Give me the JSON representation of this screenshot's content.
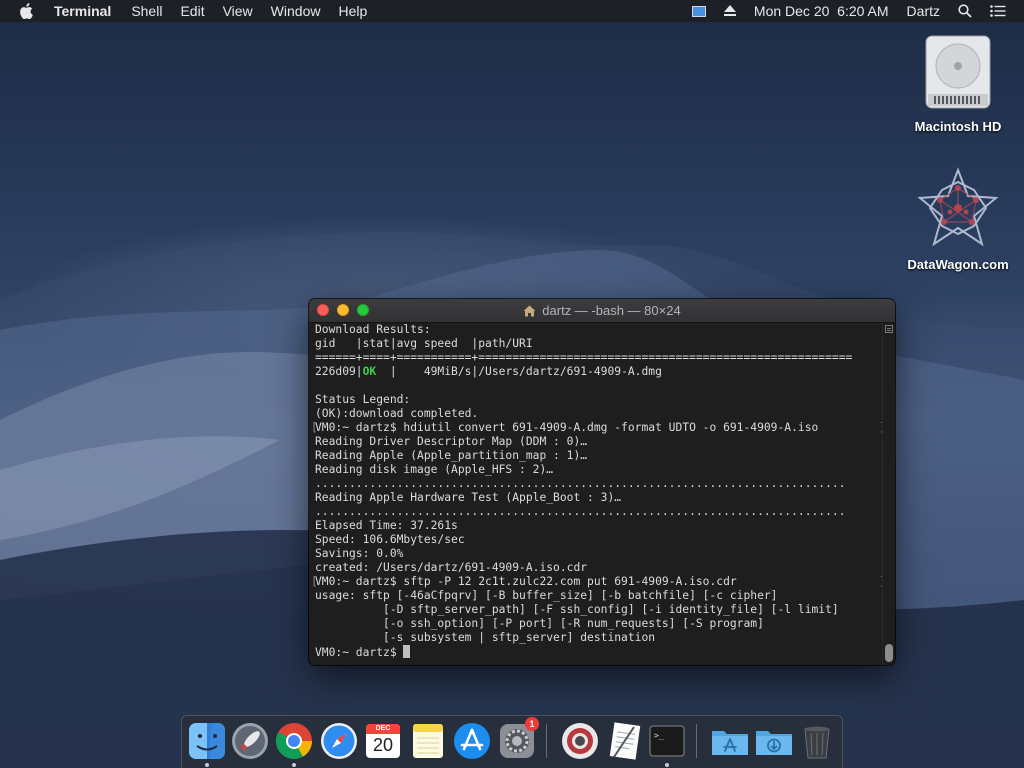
{
  "menubar": {
    "app_name": "Terminal",
    "items": [
      "Shell",
      "Edit",
      "View",
      "Window",
      "Help"
    ],
    "clock": "Mon Dec 20  6:20 AM",
    "user": "Dartz"
  },
  "desktop": {
    "icons": [
      {
        "label": "Macintosh HD",
        "icon": "hard-drive-icon"
      },
      {
        "label": "DataWagon.com",
        "icon": "datawagon-logo-icon"
      }
    ]
  },
  "terminal": {
    "title": "dartz — -bash — 80×24",
    "lines": [
      "Download Results:",
      "gid   |stat|avg speed  |path/URI",
      "======+====+===========+=======================================================",
      "226d09|OK  |    49MiB/s|/Users/dartz/691-4909-A.dmg",
      "",
      "Status Legend:",
      "(OK):download completed.",
      "VM0:~ dartz$ hdiutil convert 691-4909-A.dmg -format UDTO -o 691-4909-A.iso",
      "Reading Driver Descriptor Map (DDM : 0)…",
      "Reading Apple (Apple_partition_map : 1)…",
      "Reading disk image (Apple_HFS : 2)…",
      "..............................................................................",
      "Reading Apple Hardware Test (Apple_Boot : 3)…",
      "..............................................................................",
      "Elapsed Time: 37.261s",
      "Speed: 106.6Mbytes/sec",
      "Savings: 0.0%",
      "created: /Users/dartz/691-4909-A.iso.cdr",
      "VM0:~ dartz$ sftp -P 12 2c1t.zulc22.com put 691-4909-A.iso.cdr",
      "usage: sftp [-46aCfpqrv] [-B buffer_size] [-b batchfile] [-c cipher]",
      "          [-D sftp_server_path] [-F ssh_config] [-i identity_file] [-l limit]",
      "          [-o ssh_option] [-P port] [-R num_requests] [-S program]",
      "          [-s subsystem | sftp_server] destination"
    ],
    "ok_line": {
      "prefix": "226d09|",
      "status": "OK",
      "suffix": "  |    49MiB/s|/Users/dartz/691-4909-A.dmg"
    },
    "prompt": "VM0:~ dartz$ ",
    "marked_lines": [
      7,
      18
    ]
  },
  "dock": {
    "items": [
      {
        "icon": "finder-icon",
        "running": true
      },
      {
        "icon": "launchpad-icon",
        "running": false
      },
      {
        "icon": "chrome-icon",
        "running": true
      },
      {
        "icon": "safari-icon",
        "running": false
      },
      {
        "icon": "calendar-icon",
        "running": false,
        "month": "DEC",
        "day": "20"
      },
      {
        "icon": "notes-icon",
        "running": false
      },
      {
        "icon": "app-store-icon",
        "running": false
      },
      {
        "icon": "system-preferences-icon",
        "running": false,
        "badge": "1"
      },
      {
        "icon": "photo-booth-icon",
        "running": false
      },
      {
        "icon": "textedit-icon",
        "running": false
      },
      {
        "icon": "terminal-icon",
        "running": true
      },
      {
        "icon": "applications-folder-icon",
        "running": false
      },
      {
        "icon": "downloads-folder-icon",
        "running": false
      },
      {
        "icon": "trash-icon",
        "running": false
      }
    ]
  }
}
